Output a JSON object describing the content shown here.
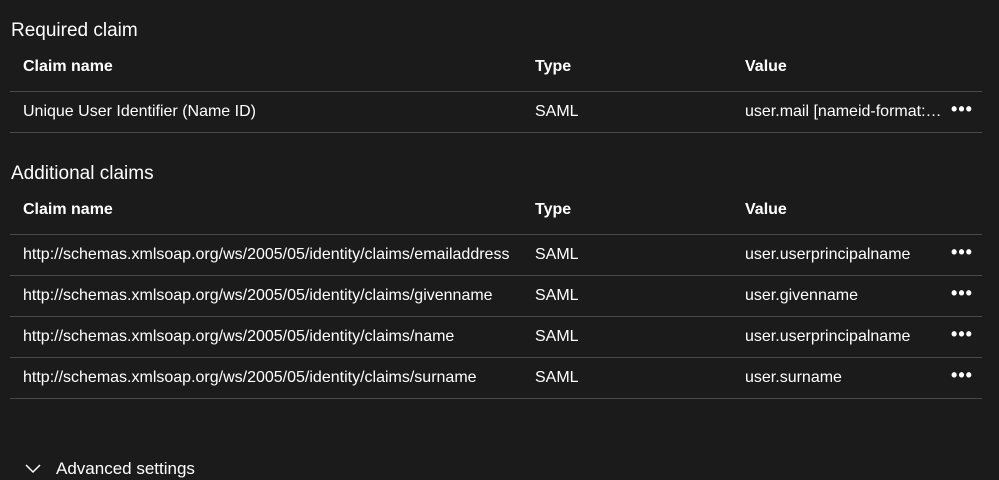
{
  "required": {
    "title": "Required claim",
    "headers": {
      "name": "Claim name",
      "type": "Type",
      "value": "Value"
    },
    "rows": [
      {
        "name": "Unique User Identifier (Name ID)",
        "type": "SAML",
        "value": "user.mail [nameid-format:emailAddress]",
        "more": "•••"
      }
    ]
  },
  "additional": {
    "title": "Additional claims",
    "headers": {
      "name": "Claim name",
      "type": "Type",
      "value": "Value"
    },
    "rows": [
      {
        "name": "http://schemas.xmlsoap.org/ws/2005/05/identity/claims/emailaddress",
        "type": "SAML",
        "value": "user.userprincipalname",
        "more": "•••"
      },
      {
        "name": "http://schemas.xmlsoap.org/ws/2005/05/identity/claims/givenname",
        "type": "SAML",
        "value": "user.givenname",
        "more": "•••"
      },
      {
        "name": "http://schemas.xmlsoap.org/ws/2005/05/identity/claims/name",
        "type": "SAML",
        "value": "user.userprincipalname",
        "more": "•••"
      },
      {
        "name": "http://schemas.xmlsoap.org/ws/2005/05/identity/claims/surname",
        "type": "SAML",
        "value": "user.surname",
        "more": "•••"
      }
    ]
  },
  "advanced": {
    "label": "Advanced settings",
    "icon": "chevron-down-icon"
  }
}
